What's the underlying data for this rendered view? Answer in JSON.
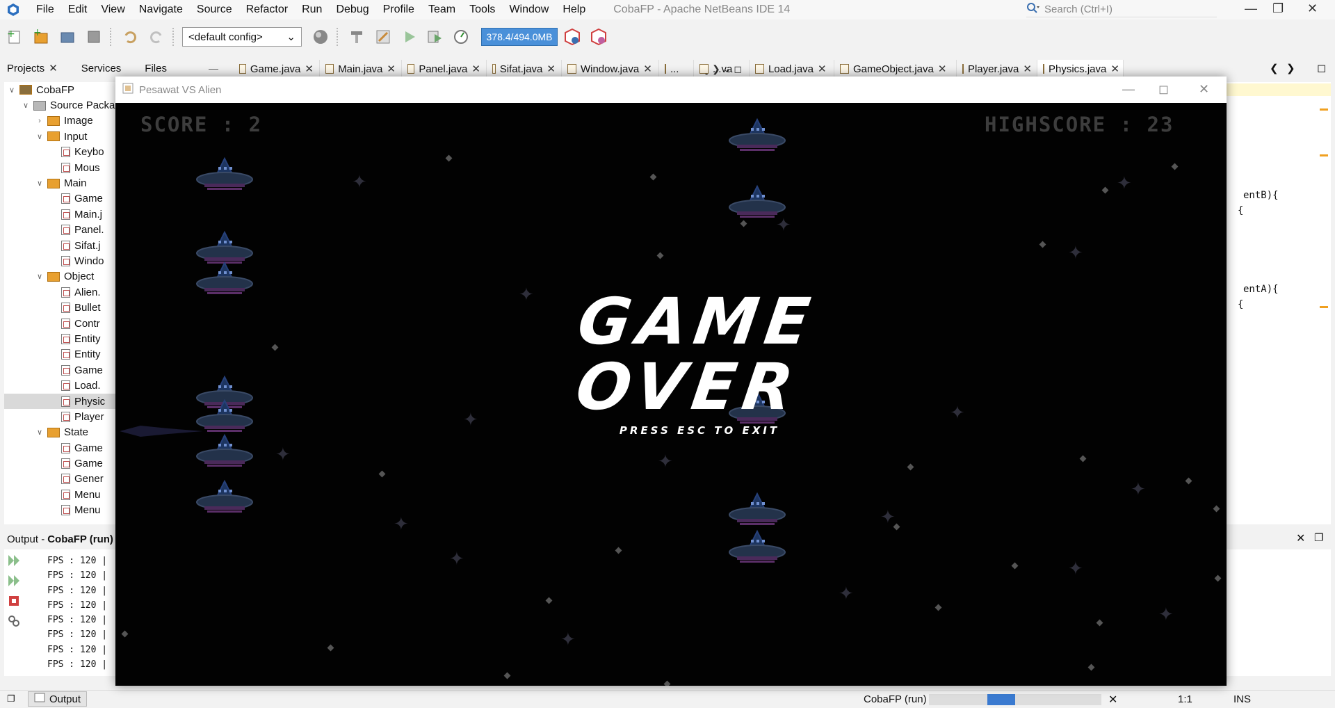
{
  "menubar": {
    "items": [
      "File",
      "Edit",
      "View",
      "Navigate",
      "Source",
      "Refactor",
      "Run",
      "Debug",
      "Profile",
      "Team",
      "Tools",
      "Window",
      "Help"
    ],
    "title": "CobaFP - Apache NetBeans IDE 14",
    "search_placeholder": "Search (Ctrl+I)"
  },
  "toolbar": {
    "config": "<default config>",
    "memory": "378.4/494.0MB"
  },
  "left_tabs": [
    "Projects",
    "Services",
    "Files"
  ],
  "editor_tabs": [
    "Game.java",
    "Main.java",
    "Panel.java",
    "Sifat.java",
    "Window.java",
    "...",
    "...va",
    "Load.java",
    "GameObject.java",
    "Player.java",
    "Physics.java"
  ],
  "project_tree": [
    {
      "label": "CobaFP",
      "indent": 0,
      "kind": "project",
      "arrow": "open"
    },
    {
      "label": "Source Packa",
      "indent": 1,
      "kind": "folder",
      "arrow": "open"
    },
    {
      "label": "Image",
      "indent": 2,
      "kind": "package",
      "arrow": "closed"
    },
    {
      "label": "Input",
      "indent": 2,
      "kind": "package",
      "arrow": "open"
    },
    {
      "label": "Keybo",
      "indent": 3,
      "kind": "file"
    },
    {
      "label": "Mous",
      "indent": 3,
      "kind": "file"
    },
    {
      "label": "Main",
      "indent": 2,
      "kind": "package",
      "arrow": "open"
    },
    {
      "label": "Game",
      "indent": 3,
      "kind": "file"
    },
    {
      "label": "Main.j",
      "indent": 3,
      "kind": "file"
    },
    {
      "label": "Panel.",
      "indent": 3,
      "kind": "file"
    },
    {
      "label": "Sifat.j",
      "indent": 3,
      "kind": "file"
    },
    {
      "label": "Windo",
      "indent": 3,
      "kind": "file"
    },
    {
      "label": "Object",
      "indent": 2,
      "kind": "package",
      "arrow": "open"
    },
    {
      "label": "Alien.",
      "indent": 3,
      "kind": "file"
    },
    {
      "label": "Bullet",
      "indent": 3,
      "kind": "file"
    },
    {
      "label": "Contr",
      "indent": 3,
      "kind": "file"
    },
    {
      "label": "Entity",
      "indent": 3,
      "kind": "file"
    },
    {
      "label": "Entity",
      "indent": 3,
      "kind": "file"
    },
    {
      "label": "Game",
      "indent": 3,
      "kind": "file"
    },
    {
      "label": "Load.",
      "indent": 3,
      "kind": "file"
    },
    {
      "label": "Physic",
      "indent": 3,
      "kind": "file",
      "selected": true
    },
    {
      "label": "Player",
      "indent": 3,
      "kind": "file"
    },
    {
      "label": "State",
      "indent": 2,
      "kind": "package",
      "arrow": "open"
    },
    {
      "label": "Game",
      "indent": 3,
      "kind": "file"
    },
    {
      "label": "Game",
      "indent": 3,
      "kind": "file"
    },
    {
      "label": "Gener",
      "indent": 3,
      "kind": "file"
    },
    {
      "label": "Menu",
      "indent": 3,
      "kind": "file"
    },
    {
      "label": "Menu",
      "indent": 3,
      "kind": "file"
    }
  ],
  "output": {
    "header_label": "Output - ",
    "header_bold": "CobaFP (run)",
    "lines": [
      "FPS : 120 |",
      "FPS : 120 |",
      "FPS : 120 |",
      "FPS : 120 |",
      "FPS : 120 |",
      "FPS : 120 |",
      "FPS : 120 |",
      "FPS : 120 |"
    ]
  },
  "code_snippets": [
    "entB){",
    "{",
    "entA){",
    "{"
  ],
  "statusbar": {
    "output_tab": "Output",
    "run_label": "CobaFP (run)",
    "position": "1:1",
    "mode": "INS"
  },
  "game_window": {
    "title": "Pesawat VS Alien",
    "score_label": "SCORE : 2",
    "highscore_label": "HIGHSCORE : 23",
    "game_over_line1": "GAME",
    "game_over_line2": "OVER",
    "subtitle": "PRESS ESC TO EXIT"
  }
}
